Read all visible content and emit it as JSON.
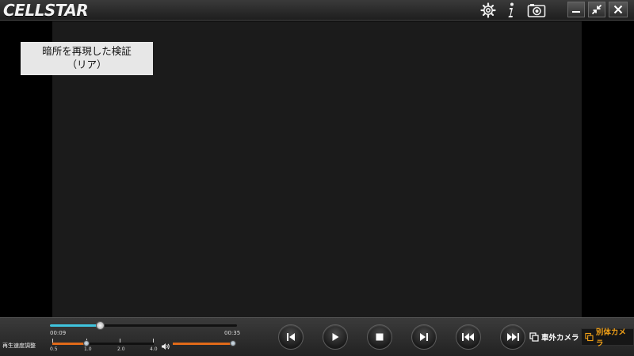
{
  "app": {
    "logo_text": "CELLSTAR"
  },
  "titlebar_icons": [
    "gear-icon",
    "info-icon",
    "camera-icon"
  ],
  "window_controls": [
    "minimize-icon",
    "restore-icon",
    "close-icon"
  ],
  "video": {
    "caption_line1": "暗所を再現した検証",
    "caption_line2": "（リア）"
  },
  "seek": {
    "current_time": "00:09",
    "total_time": "00:35",
    "progress": 0.27,
    "color": "#3fc4de"
  },
  "speed": {
    "label": "再生速度調整",
    "ticks": [
      "0.5",
      "1.0",
      "2.0",
      "4.0"
    ],
    "value": "1.0",
    "color": "#e06a19"
  },
  "volume": {
    "level": 1.0
  },
  "playback_buttons": [
    "skip-to-start-icon",
    "play-icon",
    "stop-icon",
    "skip-to-end-icon",
    "rewind-icon",
    "fast-forward-icon"
  ],
  "camera": {
    "outside_label": "車外カメラ",
    "separate_label": "別体カメラ",
    "active_color": "#f0a018"
  }
}
